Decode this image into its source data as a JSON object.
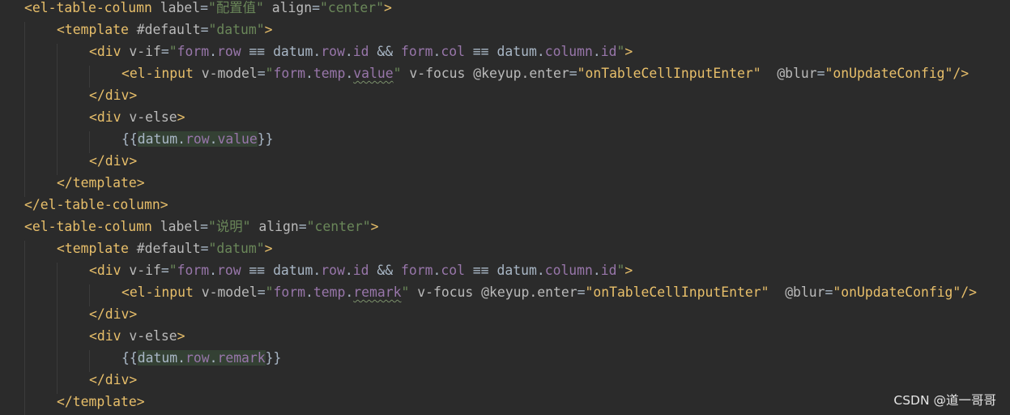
{
  "code": {
    "L1": {
      "p1": "el-table-column",
      "p2": "label",
      "p3": "\"配置值\"",
      "p4": "align",
      "p5": "\"center\""
    },
    "L2": {
      "p1": "template",
      "p2": "#default",
      "p3": "\"datum\""
    },
    "L3": {
      "p1": "div",
      "p2": "v-if",
      "p3": "form",
      "p4": "row",
      "p5": "datum",
      "p6": "row",
      "p7": "id",
      "p8": "form",
      "p9": "col",
      "p10": "datum",
      "p11": "column",
      "p12": "id"
    },
    "L4": {
      "p1": "el-input",
      "p2": "v-model",
      "p3": "form",
      "p4": "temp",
      "p5": "value",
      "p6": "v-focus",
      "p7": "@keyup.enter",
      "p8": "\"onTableCellInputEnter\"",
      "p9": "@blur",
      "p10": "\"onUpdateConfig\""
    },
    "L5": {
      "p1": "div"
    },
    "L6": {
      "p1": "div",
      "p2": "v-else"
    },
    "L7": {
      "p1": "datum",
      "p2": "row",
      "p3": "value"
    },
    "L8": {
      "p1": "div"
    },
    "L9": {
      "p1": "template"
    },
    "L10": {
      "p1": "el-table-column"
    },
    "L11": {
      "p1": "el-table-column",
      "p2": "label",
      "p3": "\"说明\"",
      "p4": "align",
      "p5": "\"center\""
    },
    "L12": {
      "p1": "template",
      "p2": "#default",
      "p3": "\"datum\""
    },
    "L13": {
      "p1": "div",
      "p2": "v-if",
      "p3": "form",
      "p4": "row",
      "p5": "datum",
      "p6": "row",
      "p7": "id",
      "p8": "form",
      "p9": "col",
      "p10": "datum",
      "p11": "column",
      "p12": "id"
    },
    "L14": {
      "p1": "el-input",
      "p2": "v-model",
      "p3": "form",
      "p4": "temp",
      "p5": "remark",
      "p6": "v-focus",
      "p7": "@keyup.enter",
      "p8": "\"onTableCellInputEnter\"",
      "p9": "@blur",
      "p10": "\"onUpdateConfig\""
    },
    "L15": {
      "p1": "div"
    },
    "L16": {
      "p1": "div",
      "p2": "v-else"
    },
    "L17": {
      "p1": "datum",
      "p2": "row",
      "p3": "remark"
    },
    "L18": {
      "p1": "div"
    },
    "L19": {
      "p1": "template"
    }
  },
  "watermark": "CSDN @道一哥哥",
  "colors": {
    "background": "#2b2b2b",
    "tag": "#e8bf6a",
    "attribute": "#bababa",
    "string": "#6a8759",
    "js_property": "#9876aa",
    "default_text": "#a9b7c6",
    "highlight": "#344134"
  }
}
